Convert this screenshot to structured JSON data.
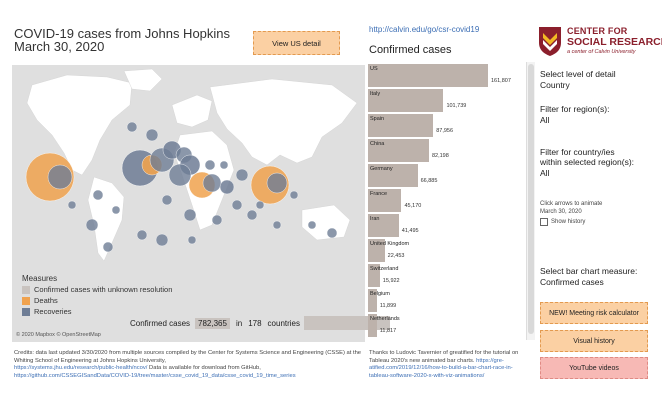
{
  "header": {
    "title_line1": "COVID-19 cases from Johns Hopkins",
    "title_line2": "March 30, 2020",
    "us_button": "View US detail",
    "source_link": "http://calvin.edu/go/csr-covid19",
    "chart_heading": "Confirmed cases"
  },
  "logo": {
    "line1": "CENTER FOR",
    "line2": "SOCIAL RESEARCH",
    "line3": "a center of Calvin University",
    "color": "#8b1f2c"
  },
  "map": {
    "legend_title": "Measures",
    "legend": [
      {
        "label": "Confirmed cases with unknown resolution",
        "color": "#c9c3bf"
      },
      {
        "label": "Deaths",
        "color": "#f0a24e"
      },
      {
        "label": "Recoveries",
        "color": "#6e7d95"
      }
    ],
    "attribution": "© 2020 Mapbox © OpenStreetMap",
    "totals_label": "Confirmed cases",
    "totals_value": "782,365",
    "totals_in": "in",
    "totals_count": "178",
    "totals_unit": "countries"
  },
  "chart_data": {
    "type": "bar",
    "orientation": "horizontal",
    "title": "Confirmed cases",
    "categories": [
      "US",
      "Italy",
      "Spain",
      "China",
      "Germany",
      "France",
      "Iran",
      "United Kingdom",
      "Switzerland",
      "Belgium",
      "Netherlands"
    ],
    "values": [
      161807,
      101739,
      87956,
      82198,
      66885,
      45170,
      41495,
      22453,
      15922,
      11899,
      11817
    ],
    "value_labels": [
      "161,807",
      "101,739",
      "87,956",
      "82,198",
      "66,885",
      "45,170",
      "41,495",
      "22,453",
      "15,922",
      "11,899",
      "11,817"
    ],
    "bar_color": "#bdb2ab"
  },
  "controls": {
    "level_label": "Select level of detail",
    "level_value": "Country",
    "region_label": "Filter for region(s):",
    "region_value": "All",
    "country_label1": "Filter for country/ies",
    "country_label2": "within selected region(s):",
    "country_value": "All",
    "animate_label": "Click arrows to animate",
    "animate_date": "March 30, 2020",
    "show_history": "Show history",
    "measure_label": "Select bar chart measure:",
    "measure_value": "Confirmed cases"
  },
  "buttons": [
    {
      "label": "NEW! Meeting risk calculator",
      "bg": "#fbd0a3",
      "border": "#e39a4f"
    },
    {
      "label": "Visual history",
      "bg": "#fbd0a3",
      "border": "#e39a4f"
    },
    {
      "label": "YouTube videos",
      "bg": "#f7b9b5",
      "border": "#e08a84"
    }
  ],
  "footer": {
    "credits_text": "Credits: data last updated 3/30/2020 from multiple sources compiled by the Center for Systems Science and Engineering (CSSE) at the Whiting School of Engineering at Johns Hopkins University,",
    "credits_link1": "https://systems.jhu.edu/research/public-health/ncov/",
    "credits_mid": " Data is available for download from GitHub,",
    "credits_link2": "https://github.com/CSSEGISandData/COVID-19/tree/master/csse_covid_19_data/csse_covid_19_time_series",
    "thanks_text": "Thanks to Ludovic Tavernier of greatified for the tutorial on Tableau 2020's new animated bar charts.",
    "thanks_link": "https://gre-atified.com/2019/12/16/how-to-build-a-bar-chart-race-in-tableau-software-2020-x-with-viz-animations/"
  }
}
